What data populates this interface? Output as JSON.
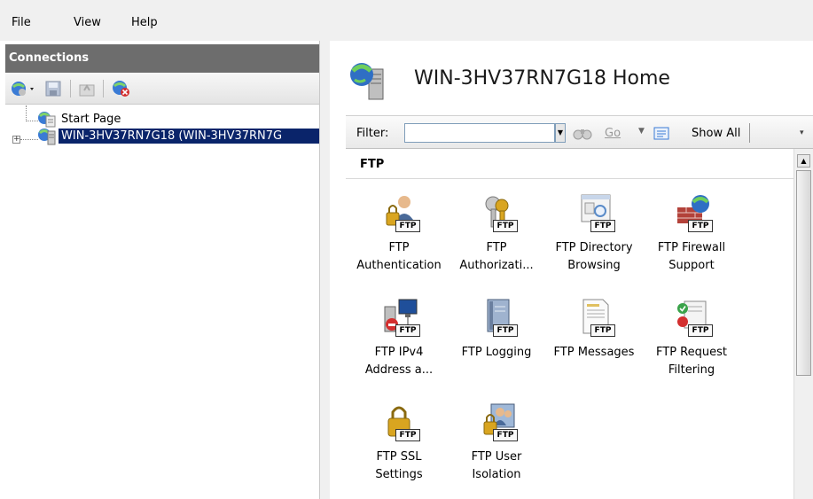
{
  "menu": {
    "file": "File",
    "view": "View",
    "help": "Help"
  },
  "connections": {
    "title": "Connections",
    "tree": [
      {
        "label": "Start Page"
      },
      {
        "label": "WIN-3HV37RN7G18 (WIN-3HV37RN7G"
      }
    ]
  },
  "main": {
    "title": "WIN-3HV37RN7G18 Home",
    "filter_label": "Filter:",
    "filter_value": "",
    "go_label": "Go",
    "show_all_label": "Show All",
    "group_label": "FTP",
    "badge_text": "FTP",
    "features": [
      {
        "line1": "FTP",
        "line2": "Authentication"
      },
      {
        "line1": "FTP",
        "line2": "Authorizati..."
      },
      {
        "line1": "FTP Directory",
        "line2": "Browsing"
      },
      {
        "line1": "FTP Firewall",
        "line2": "Support"
      },
      {
        "line1": "FTP IPv4",
        "line2": "Address a..."
      },
      {
        "line1": "FTP Logging",
        "line2": ""
      },
      {
        "line1": "FTP Messages",
        "line2": ""
      },
      {
        "line1": "FTP Request",
        "line2": "Filtering"
      },
      {
        "line1": "FTP SSL",
        "line2": "Settings"
      },
      {
        "line1": "FTP User",
        "line2": "Isolation"
      }
    ]
  },
  "icons": {
    "back": "back-arrow-icon",
    "save": "save-icon",
    "up": "folder-up-icon",
    "disconnect": "disconnect-icon",
    "server": "server-globe-icon"
  }
}
